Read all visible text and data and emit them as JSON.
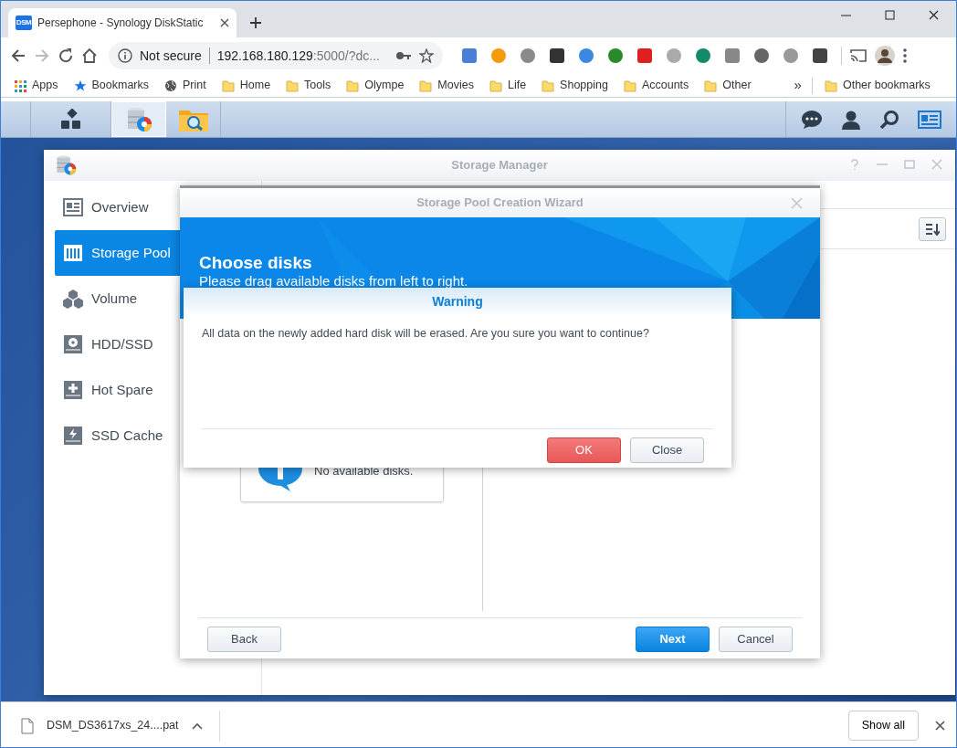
{
  "browser": {
    "tab": {
      "favicon_text": "DSM",
      "title": "Persephone - Synology DiskStatic"
    },
    "address": {
      "security": "Not secure",
      "host": "192.168.180.129",
      "rest": ":5000/?dc..."
    },
    "bookmarks": [
      {
        "label": "Apps",
        "kind": "apps"
      },
      {
        "label": "Bookmarks",
        "kind": "star"
      },
      {
        "label": "Print",
        "kind": "globe"
      },
      {
        "label": "Home",
        "kind": "folder"
      },
      {
        "label": "Tools",
        "kind": "folder"
      },
      {
        "label": "Olympe",
        "kind": "folder"
      },
      {
        "label": "Movies",
        "kind": "folder"
      },
      {
        "label": "Life",
        "kind": "folder"
      },
      {
        "label": "Shopping",
        "kind": "folder"
      },
      {
        "label": "Accounts",
        "kind": "folder"
      },
      {
        "label": "Other",
        "kind": "folder"
      }
    ],
    "overflow": "»",
    "other_bookmarks": "Other bookmarks"
  },
  "taskbar": {
    "apps": [
      {
        "selected": false
      },
      {
        "selected": true
      },
      {
        "selected": false
      }
    ]
  },
  "storage_manager": {
    "title": "Storage Manager",
    "sidebar": [
      {
        "label": "Overview",
        "selected": false
      },
      {
        "label": "Storage Pool",
        "selected": true
      },
      {
        "label": "Volume",
        "selected": false
      },
      {
        "label": "HDD/SSD",
        "selected": false
      },
      {
        "label": "Hot Spare",
        "selected": false
      },
      {
        "label": "SSD Cache",
        "selected": false
      }
    ]
  },
  "wizard": {
    "title": "Storage Pool Creation Wizard",
    "heading": "Choose disks",
    "subheading": "Please drag available disks from left to right.",
    "empty_text": "No available disks.",
    "buttons": [
      {
        "label": "Back",
        "kind": "default"
      },
      {
        "label": "Next",
        "kind": "primary"
      },
      {
        "label": "Cancel",
        "kind": "default"
      }
    ]
  },
  "dialog": {
    "title": "Warning",
    "message": "All data on the newly added hard disk will be erased. Are you sure you want to continue?",
    "buttons": [
      {
        "label": "OK",
        "kind": "danger"
      },
      {
        "label": "Close",
        "kind": "default"
      }
    ]
  },
  "downloads": {
    "file": "DSM_DS3617xs_24....pat",
    "show_all": "Show all"
  }
}
